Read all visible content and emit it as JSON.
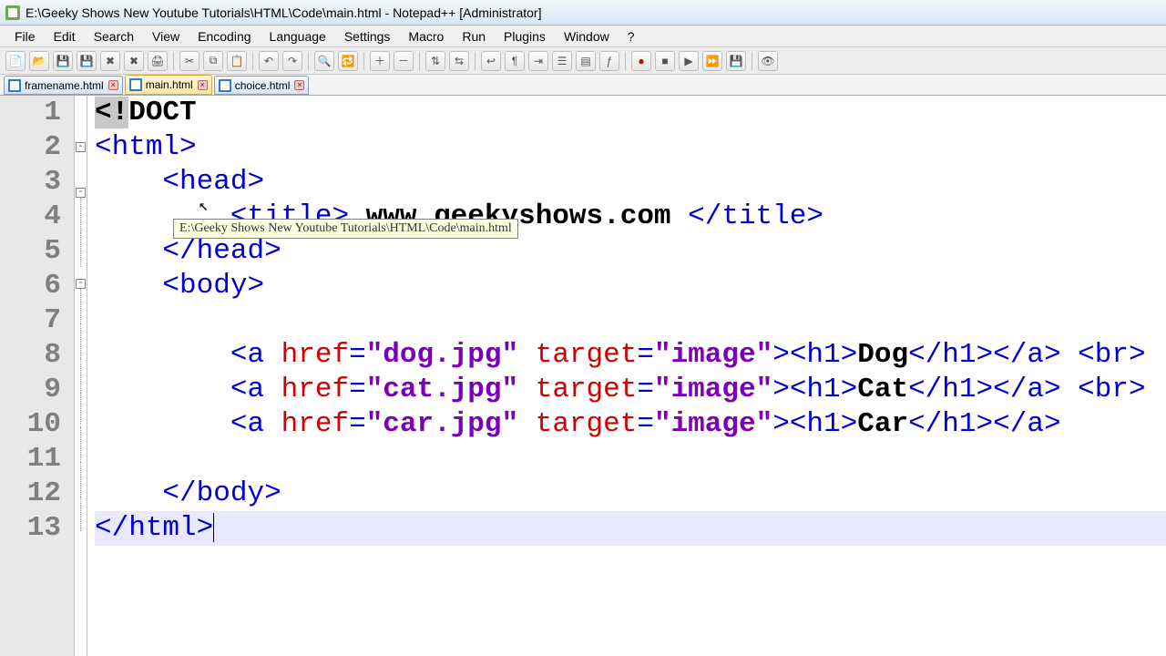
{
  "titlebar": {
    "text": "E:\\Geeky Shows New Youtube Tutorials\\HTML\\Code\\main.html - Notepad++ [Administrator]"
  },
  "menu": [
    "File",
    "Edit",
    "Search",
    "View",
    "Encoding",
    "Language",
    "Settings",
    "Macro",
    "Run",
    "Plugins",
    "Window",
    "?"
  ],
  "tabs": [
    {
      "label": "framename.html",
      "active": false
    },
    {
      "label": "main.html",
      "active": true
    },
    {
      "label": "choice.html",
      "active": false
    }
  ],
  "tooltip": "E:\\Geeky Shows New Youtube Tutorials\\HTML\\Code\\main.html",
  "gutter": [
    "1",
    "2",
    "3",
    "4",
    "5",
    "6",
    "7",
    "8",
    "9",
    "10",
    "11",
    "12",
    "13"
  ],
  "code": {
    "l1_a": "<!",
    "l1_b": "DOCT",
    "l2_o": "<",
    "l2_t": "html",
    "l2_c": ">",
    "l3_i": "    ",
    "l3_o": "<",
    "l3_t": "head",
    "l3_c": ">",
    "l4_i": "        ",
    "l4_o": "<",
    "l4_t": "title",
    "l4_c": ">",
    "l4_x": " www.geekyshows.com ",
    "l4_o2": "</",
    "l4_t2": "title",
    "l4_c2": ">",
    "l5_i": "    ",
    "l5_o": "</",
    "l5_t": "head",
    "l5_c": ">",
    "l6_i": "    ",
    "l6_o": "<",
    "l6_t": "body",
    "l6_c": ">",
    "l7_i": "        ",
    "l8_i": "        ",
    "l8_o": "<",
    "l8_t": "a",
    "l8_sp": " ",
    "l8_a1": "href",
    "l8_e": "=",
    "l8_v1": "\"dog.jpg\"",
    "l8_sp2": " ",
    "l8_a2": "target",
    "l8_e2": "=",
    "l8_v2": "\"image\"",
    "l8_c": ">",
    "l8_ho": "<",
    "l8_ht": "h1",
    "l8_hc": ">",
    "l8_x": "Dog",
    "l8_hco": "</",
    "l8_ht2": "h1",
    "l8_hcc": ">",
    "l8_co": "</",
    "l8_ct": "a",
    "l8_cc": ">",
    "l8_br": " <",
    "l8_brt": "br",
    "l8_brc": ">",
    "l9_i": "        ",
    "l9_o": "<",
    "l9_t": "a",
    "l9_sp": " ",
    "l9_a1": "href",
    "l9_e": "=",
    "l9_v1": "\"cat.jpg\"",
    "l9_sp2": " ",
    "l9_a2": "target",
    "l9_e2": "=",
    "l9_v2": "\"image\"",
    "l9_c": ">",
    "l9_ho": "<",
    "l9_ht": "h1",
    "l9_hc": ">",
    "l9_x": "Cat",
    "l9_hco": "</",
    "l9_ht2": "h1",
    "l9_hcc": ">",
    "l9_co": "</",
    "l9_ct": "a",
    "l9_cc": ">",
    "l9_br": " <",
    "l9_brt": "br",
    "l9_brc": ">",
    "l10_i": "        ",
    "l10_o": "<",
    "l10_t": "a",
    "l10_sp": " ",
    "l10_a1": "href",
    "l10_e": "=",
    "l10_v1": "\"car.jpg\"",
    "l10_sp2": " ",
    "l10_a2": "target",
    "l10_e2": "=",
    "l10_v2": "\"image\"",
    "l10_c": ">",
    "l10_ho": "<",
    "l10_ht": "h1",
    "l10_hc": ">",
    "l10_x": "Car",
    "l10_hco": "</",
    "l10_ht2": "h1",
    "l10_hcc": ">",
    "l10_co": "</",
    "l10_ct": "a",
    "l10_cc": ">",
    "l11_i": "        ",
    "l12_i": "    ",
    "l12_o": "</",
    "l12_t": "body",
    "l12_c": ">",
    "l13_o": "</",
    "l13_t": "html",
    "l13_c": ">"
  }
}
